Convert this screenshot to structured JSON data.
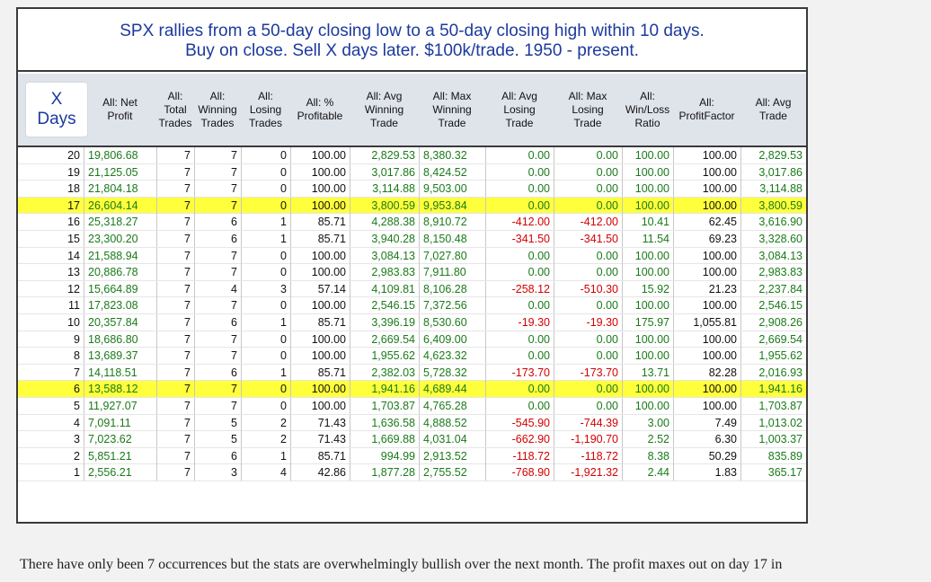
{
  "title": {
    "line1": "SPX rallies from a 50-day closing low to a 50-day closing high within 10 days.",
    "line2": "Buy on close. Sell X days later. $100k/trade. 1950 - present."
  },
  "header": {
    "xdays_line1": "X",
    "xdays_line2": "Days",
    "columns": [
      [
        "All: Net",
        "Profit"
      ],
      [
        "All:",
        "Total",
        "Trades"
      ],
      [
        "All:",
        "Winning",
        "Trades"
      ],
      [
        "All:",
        "Losing",
        "Trades"
      ],
      [
        "All: %",
        "Profitable"
      ],
      [
        "All: Avg",
        "Winning",
        "Trade"
      ],
      [
        "All: Max",
        "Winning",
        "Trade"
      ],
      [
        "All: Avg",
        "Losing",
        "Trade"
      ],
      [
        "All: Max",
        "Losing",
        "Trade"
      ],
      [
        "All:",
        "Win/Loss",
        "Ratio"
      ],
      [
        "All:",
        "ProfitFactor"
      ],
      [
        "All: Avg",
        "Trade"
      ]
    ]
  },
  "rows": [
    {
      "x": "20",
      "net": "19,806.68",
      "tot": "7",
      "win": "7",
      "los": "0",
      "pct": "100.00",
      "avgw": "2,829.53",
      "maxw": "8,380.32",
      "avgl": "0.00",
      "maxl": "0.00",
      "wl": "100.00",
      "pf": "100.00",
      "avg": "2,829.53",
      "hl": false
    },
    {
      "x": "19",
      "net": "21,125.05",
      "tot": "7",
      "win": "7",
      "los": "0",
      "pct": "100.00",
      "avgw": "3,017.86",
      "maxw": "8,424.52",
      "avgl": "0.00",
      "maxl": "0.00",
      "wl": "100.00",
      "pf": "100.00",
      "avg": "3,017.86",
      "hl": false
    },
    {
      "x": "18",
      "net": "21,804.18",
      "tot": "7",
      "win": "7",
      "los": "0",
      "pct": "100.00",
      "avgw": "3,114.88",
      "maxw": "9,503.00",
      "avgl": "0.00",
      "maxl": "0.00",
      "wl": "100.00",
      "pf": "100.00",
      "avg": "3,114.88",
      "hl": false
    },
    {
      "x": "17",
      "net": "26,604.14",
      "tot": "7",
      "win": "7",
      "los": "0",
      "pct": "100.00",
      "avgw": "3,800.59",
      "maxw": "9,953.84",
      "avgl": "0.00",
      "maxl": "0.00",
      "wl": "100.00",
      "pf": "100.00",
      "avg": "3,800.59",
      "hl": true
    },
    {
      "x": "16",
      "net": "25,318.27",
      "tot": "7",
      "win": "6",
      "los": "1",
      "pct": "85.71",
      "avgw": "4,288.38",
      "maxw": "8,910.72",
      "avgl": "-412.00",
      "maxl": "-412.00",
      "wl": "10.41",
      "pf": "62.45",
      "avg": "3,616.90",
      "hl": false
    },
    {
      "x": "15",
      "net": "23,300.20",
      "tot": "7",
      "win": "6",
      "los": "1",
      "pct": "85.71",
      "avgw": "3,940.28",
      "maxw": "8,150.48",
      "avgl": "-341.50",
      "maxl": "-341.50",
      "wl": "11.54",
      "pf": "69.23",
      "avg": "3,328.60",
      "hl": false
    },
    {
      "x": "14",
      "net": "21,588.94",
      "tot": "7",
      "win": "7",
      "los": "0",
      "pct": "100.00",
      "avgw": "3,084.13",
      "maxw": "7,027.80",
      "avgl": "0.00",
      "maxl": "0.00",
      "wl": "100.00",
      "pf": "100.00",
      "avg": "3,084.13",
      "hl": false
    },
    {
      "x": "13",
      "net": "20,886.78",
      "tot": "7",
      "win": "7",
      "los": "0",
      "pct": "100.00",
      "avgw": "2,983.83",
      "maxw": "7,911.80",
      "avgl": "0.00",
      "maxl": "0.00",
      "wl": "100.00",
      "pf": "100.00",
      "avg": "2,983.83",
      "hl": false
    },
    {
      "x": "12",
      "net": "15,664.89",
      "tot": "7",
      "win": "4",
      "los": "3",
      "pct": "57.14",
      "avgw": "4,109.81",
      "maxw": "8,106.28",
      "avgl": "-258.12",
      "maxl": "-510.30",
      "wl": "15.92",
      "pf": "21.23",
      "avg": "2,237.84",
      "hl": false
    },
    {
      "x": "11",
      "net": "17,823.08",
      "tot": "7",
      "win": "7",
      "los": "0",
      "pct": "100.00",
      "avgw": "2,546.15",
      "maxw": "7,372.56",
      "avgl": "0.00",
      "maxl": "0.00",
      "wl": "100.00",
      "pf": "100.00",
      "avg": "2,546.15",
      "hl": false
    },
    {
      "x": "10",
      "net": "20,357.84",
      "tot": "7",
      "win": "6",
      "los": "1",
      "pct": "85.71",
      "avgw": "3,396.19",
      "maxw": "8,530.60",
      "avgl": "-19.30",
      "maxl": "-19.30",
      "wl": "175.97",
      "pf": "1,055.81",
      "avg": "2,908.26",
      "hl": false
    },
    {
      "x": "9",
      "net": "18,686.80",
      "tot": "7",
      "win": "7",
      "los": "0",
      "pct": "100.00",
      "avgw": "2,669.54",
      "maxw": "6,409.00",
      "avgl": "0.00",
      "maxl": "0.00",
      "wl": "100.00",
      "pf": "100.00",
      "avg": "2,669.54",
      "hl": false
    },
    {
      "x": "8",
      "net": "13,689.37",
      "tot": "7",
      "win": "7",
      "los": "0",
      "pct": "100.00",
      "avgw": "1,955.62",
      "maxw": "4,623.32",
      "avgl": "0.00",
      "maxl": "0.00",
      "wl": "100.00",
      "pf": "100.00",
      "avg": "1,955.62",
      "hl": false
    },
    {
      "x": "7",
      "net": "14,118.51",
      "tot": "7",
      "win": "6",
      "los": "1",
      "pct": "85.71",
      "avgw": "2,382.03",
      "maxw": "5,728.32",
      "avgl": "-173.70",
      "maxl": "-173.70",
      "wl": "13.71",
      "pf": "82.28",
      "avg": "2,016.93",
      "hl": false
    },
    {
      "x": "6",
      "net": "13,588.12",
      "tot": "7",
      "win": "7",
      "los": "0",
      "pct": "100.00",
      "avgw": "1,941.16",
      "maxw": "4,689.44",
      "avgl": "0.00",
      "maxl": "0.00",
      "wl": "100.00",
      "pf": "100.00",
      "avg": "1,941.16",
      "hl": true
    },
    {
      "x": "5",
      "net": "11,927.07",
      "tot": "7",
      "win": "7",
      "los": "0",
      "pct": "100.00",
      "avgw": "1,703.87",
      "maxw": "4,765.28",
      "avgl": "0.00",
      "maxl": "0.00",
      "wl": "100.00",
      "pf": "100.00",
      "avg": "1,703.87",
      "hl": false
    },
    {
      "x": "4",
      "net": "7,091.11",
      "tot": "7",
      "win": "5",
      "los": "2",
      "pct": "71.43",
      "avgw": "1,636.58",
      "maxw": "4,888.52",
      "avgl": "-545.90",
      "maxl": "-744.39",
      "wl": "3.00",
      "pf": "7.49",
      "avg": "1,013.02",
      "hl": false
    },
    {
      "x": "3",
      "net": "7,023.62",
      "tot": "7",
      "win": "5",
      "los": "2",
      "pct": "71.43",
      "avgw": "1,669.88",
      "maxw": "4,031.04",
      "avgl": "-662.90",
      "maxl": "-1,190.70",
      "wl": "2.52",
      "pf": "6.30",
      "avg": "1,003.37",
      "hl": false
    },
    {
      "x": "2",
      "net": "5,851.21",
      "tot": "7",
      "win": "6",
      "los": "1",
      "pct": "85.71",
      "avgw": "994.99",
      "maxw": "2,913.52",
      "avgl": "-118.72",
      "maxl": "-118.72",
      "wl": "8.38",
      "pf": "50.29",
      "avg": "835.89",
      "hl": false
    },
    {
      "x": "1",
      "net": "2,556.21",
      "tot": "7",
      "win": "3",
      "los": "4",
      "pct": "42.86",
      "avgw": "1,877.28",
      "maxw": "2,755.52",
      "avgl": "-768.90",
      "maxl": "-1,921.32",
      "wl": "2.44",
      "pf": "1.83",
      "avg": "365.17",
      "hl": false
    }
  ],
  "caption": "There have only been 7 occurrences but the stats are overwhelmingly bullish over the next month. The profit maxes out on day 17 in",
  "colors": {
    "title_blue": "#1c3a9e",
    "positive": "#1a7a1a",
    "negative": "#d40000",
    "highlight": "#ffff3c",
    "header_bg": "#dfe3ea"
  }
}
